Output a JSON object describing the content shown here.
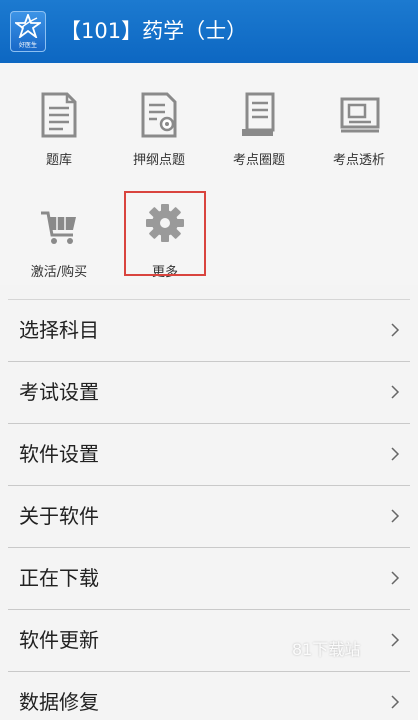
{
  "header": {
    "title": "【101】药学（士）",
    "logo_text": "好医生"
  },
  "tiles": [
    {
      "label": "题库",
      "icon": "document-icon"
    },
    {
      "label": "押纲点题",
      "icon": "certificate-document-icon"
    },
    {
      "label": "考点圈题",
      "icon": "scroll-icon"
    },
    {
      "label": "考点透析",
      "icon": "presentation-board-icon"
    },
    {
      "label": "激活/购买",
      "icon": "shopping-cart-icon"
    },
    {
      "label": "更多",
      "icon": "gear-icon"
    }
  ],
  "menu": [
    {
      "label": "选择科目"
    },
    {
      "label": "考试设置"
    },
    {
      "label": "软件设置"
    },
    {
      "label": "关于软件"
    },
    {
      "label": "正在下载"
    },
    {
      "label": "软件更新"
    },
    {
      "label": "数据修复"
    }
  ],
  "watermark": "81下载站",
  "colors": {
    "header": "#1270c8",
    "highlight_border": "#d9443e",
    "icon_gray": "#8a8a8a"
  }
}
